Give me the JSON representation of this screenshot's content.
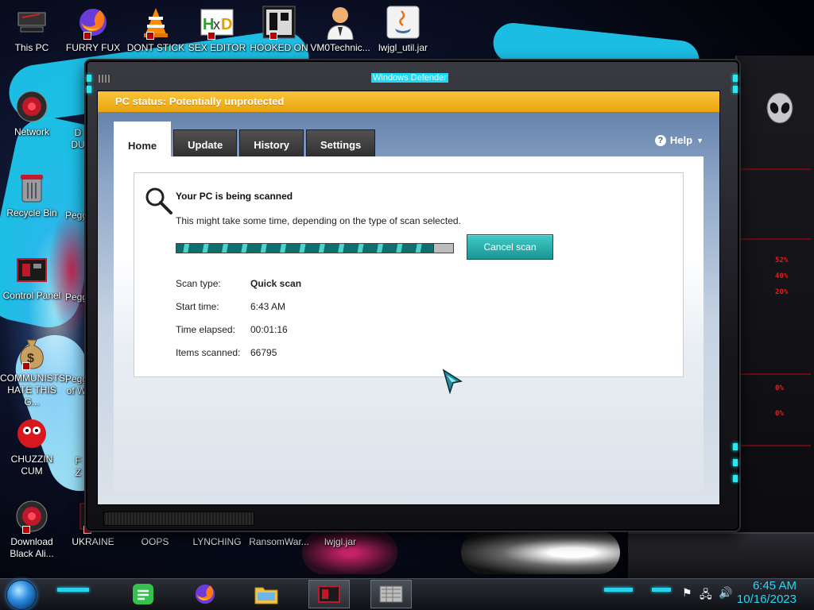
{
  "desktop": {
    "icons": [
      {
        "label": "This PC",
        "icon": "this-pc-icon"
      },
      {
        "label": "FURRY FUX",
        "icon": "firefox-icon"
      },
      {
        "label": "DONT STICK",
        "icon": "vlc-icon"
      },
      {
        "label": "SEX EDITOR",
        "icon": "hxd-icon"
      },
      {
        "label": "HOOKED ON",
        "icon": "app-icon"
      },
      {
        "label": "VM0Technic...",
        "icon": "doctor-icon"
      },
      {
        "label": "lwjgl_util.jar",
        "icon": "java-icon"
      },
      {
        "label": "Network",
        "icon": "network-icon"
      },
      {
        "label": "Recycle Bin",
        "icon": "recycle-bin-icon"
      },
      {
        "label": "Control Panel",
        "icon": "control-panel-icon"
      },
      {
        "label": "COMMUNISTS\nHATE THIS G...",
        "icon": "money-bag-icon"
      },
      {
        "label": "CHUZZIN\nCUM",
        "icon": "chuzzle-icon"
      },
      {
        "label": "Download\nBlack Ali...",
        "icon": "alien-icon"
      },
      {
        "label": "UKRAINE",
        "icon": "app-icon"
      },
      {
        "label": "OOPS",
        "icon": "file-icon"
      },
      {
        "label": "LYNCHING",
        "icon": "file-icon"
      },
      {
        "label": "RansomWar...",
        "icon": "file-icon"
      },
      {
        "label": "lwjgl.jar",
        "icon": "file-icon"
      }
    ],
    "partial_labels": [
      "D\nDU",
      "Pegg",
      "Pegg",
      "Pegg\nof W",
      "F\nZ"
    ]
  },
  "window": {
    "title": "Windows Defender"
  },
  "defender": {
    "status": "PC status: Potentially unprotected",
    "tabs": [
      "Home",
      "Update",
      "History",
      "Settings"
    ],
    "active_tab": "Home",
    "help": "Help",
    "scan": {
      "title": "Your PC is being scanned",
      "subtitle": "This might take some time, depending on the type of scan selected.",
      "progress": 0.93,
      "cancel_label": "Cancel scan",
      "rows": [
        {
          "label": "Scan type:",
          "value": "Quick scan",
          "bold": true
        },
        {
          "label": "Start time:",
          "value": "6:43 AM",
          "bold": false
        },
        {
          "label": "Time elapsed:",
          "value": "00:01:16",
          "bold": false
        },
        {
          "label": "Items scanned:",
          "value": "66795",
          "bold": false
        }
      ]
    }
  },
  "hud": {
    "percents": [
      "52%",
      "40%",
      "20%",
      "0%",
      "0%"
    ]
  },
  "taskbar": {
    "apps": [
      "notes-app-icon",
      "firefox-icon",
      "file-explorer-icon",
      "hud-app-icon",
      "defender-app-icon"
    ],
    "time": "6:45 AM",
    "date": "10/16/2023"
  },
  "colors": {
    "status_yellow": "#f0ad14",
    "accent_teal": "#1fa6a3",
    "clock_cyan": "#27d6f2"
  }
}
